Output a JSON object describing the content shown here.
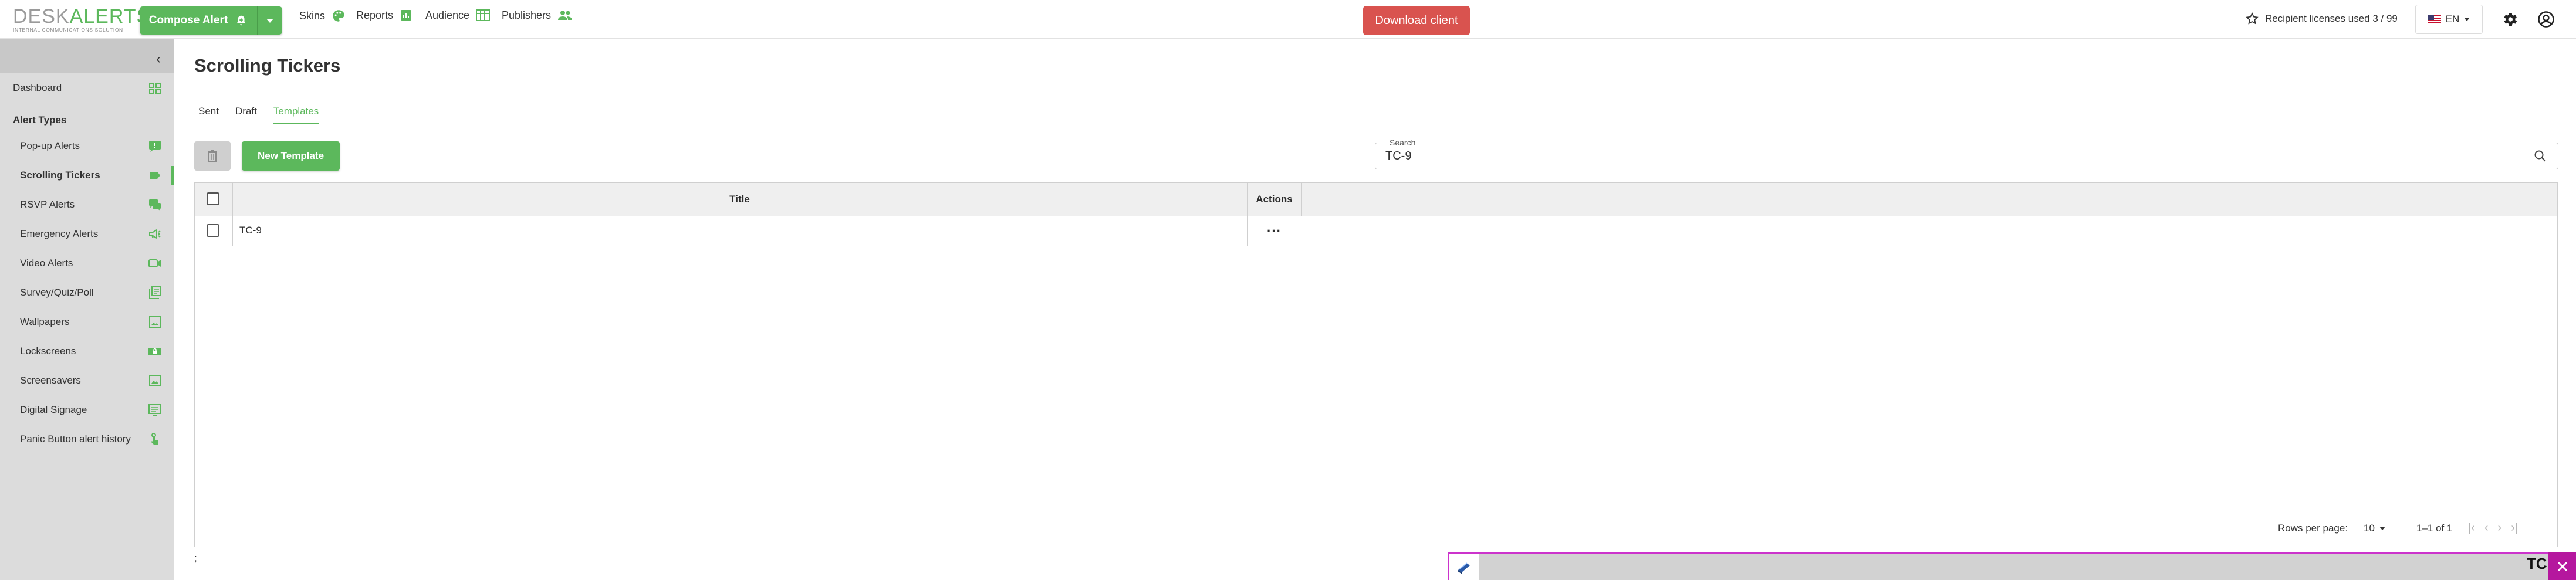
{
  "app": {
    "logo_main": "DESK",
    "logo_accent": "ALERTS",
    "logo_tagline": "INTERNAL COMMUNICATIONS SOLUTION"
  },
  "topbar": {
    "compose_label": "Compose Alert",
    "nav": [
      {
        "label": "Skins",
        "icon": "palette-icon"
      },
      {
        "label": "Reports",
        "icon": "chart-icon"
      },
      {
        "label": "Audience",
        "icon": "table-icon"
      },
      {
        "label": "Publishers",
        "icon": "people-icon"
      }
    ],
    "download_label": "Download client",
    "licenses_text": "Recipient licenses used 3 / 99",
    "language": "EN"
  },
  "sidebar": {
    "dashboard": "Dashboard",
    "section_title": "Alert Types",
    "items": [
      {
        "label": "Pop-up Alerts",
        "icon": "popup-icon"
      },
      {
        "label": "Scrolling Tickers",
        "icon": "ticker-icon",
        "active": true
      },
      {
        "label": "RSVP Alerts",
        "icon": "chat-icon"
      },
      {
        "label": "Emergency Alerts",
        "icon": "megaphone-icon"
      },
      {
        "label": "Video Alerts",
        "icon": "video-icon"
      },
      {
        "label": "Survey/Quiz/Poll",
        "icon": "survey-icon"
      },
      {
        "label": "Wallpapers",
        "icon": "image-icon"
      },
      {
        "label": "Lockscreens",
        "icon": "lockscreen-icon"
      },
      {
        "label": "Screensavers",
        "icon": "screensaver-icon"
      },
      {
        "label": "Digital Signage",
        "icon": "signage-icon"
      },
      {
        "label": "Panic Button alert history",
        "icon": "hand-icon"
      }
    ]
  },
  "page": {
    "title": "Scrolling Tickers",
    "tabs": [
      "Sent",
      "Draft",
      "Templates"
    ],
    "active_tab": "Templates",
    "new_template_label": "New Template",
    "search_label": "Search",
    "search_value": "TC-9"
  },
  "table": {
    "columns": [
      "Title",
      "Actions"
    ],
    "rows": [
      {
        "title": "TC-9",
        "actions": "···"
      }
    ],
    "rows_per_page_label": "Rows per page:",
    "rows_per_page": "10",
    "range": "1–1 of 1"
  },
  "misc": {
    "stray_text": ";",
    "overlay_text": "TC"
  },
  "colors": {
    "accent": "#5cb85c",
    "danger": "#d9534f",
    "sidebar_bg": "#dcdcdc",
    "overlay_border": "#cc33cc"
  }
}
